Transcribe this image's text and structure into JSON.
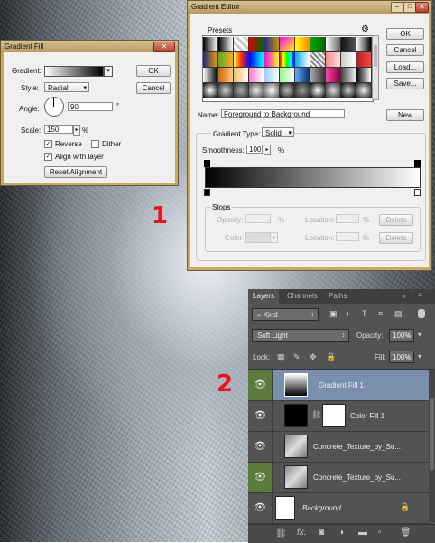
{
  "gradient_fill": {
    "title": "Gradient Fill",
    "gradient_label": "Gradient:",
    "style_label": "Style:",
    "style_value": "Radial",
    "angle_label": "Angle:",
    "angle_value": "90",
    "degree_symbol": "°",
    "scale_label": "Scale:",
    "scale_value": "150",
    "percent": "%",
    "reverse_label": "Reverse",
    "dither_label": "Dither",
    "align_label": "Align with layer",
    "reset_label": "Reset Alignment",
    "ok": "OK",
    "cancel": "Cancel",
    "reverse_checked": true,
    "dither_checked": false,
    "align_checked": true
  },
  "gradient_editor": {
    "title": "Gradient Editor",
    "presets_label": "Presets",
    "ok": "OK",
    "cancel": "Cancel",
    "load": "Load...",
    "save": "Save...",
    "name_label": "Name:",
    "name_value": "Foreground to Background",
    "new": "New",
    "type_label": "Gradient Type:",
    "type_value": "Solid",
    "smoothness_label": "Smoothness:",
    "smoothness_value": "100",
    "percent": "%",
    "stops_label": "Stops",
    "opacity_label": "Opacity:",
    "location_label": "Location:",
    "delete": "Delete",
    "color_label": "Color:"
  },
  "layers_panel": {
    "tabs": [
      "Layers",
      "Channels",
      "Paths"
    ],
    "filter_kind": "Kind",
    "blend_mode": "Soft Light",
    "opacity_label": "Opacity:",
    "opacity_value": "100%",
    "lock_label": "Lock:",
    "fill_label": "Fill:",
    "fill_value": "100%",
    "layers": [
      {
        "name": "Gradient Fill 1"
      },
      {
        "name": "Color Fill 1"
      },
      {
        "name": "Concrete_Texture_by_Su..."
      },
      {
        "name": "Concrete_Texture_by_Su..."
      },
      {
        "name": "Background"
      }
    ],
    "selected_layer": "Gradient Fill 1",
    "bottom_fx": "fx."
  },
  "annotations": {
    "marker1": "1",
    "marker2": "2"
  },
  "colors": {
    "selected_row": "#7a8fad",
    "eye_active_bg": "#5c7a3c",
    "title_gold": "#c9a86a"
  }
}
